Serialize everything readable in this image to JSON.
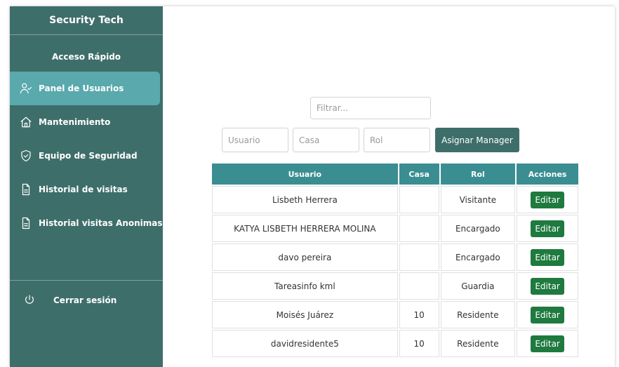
{
  "sidebar": {
    "brand": "Security Tech",
    "section_title": "Acceso Rápido",
    "items": [
      {
        "label": "Panel de Usuarios",
        "icon": "user-check-icon",
        "active": true
      },
      {
        "label": "Mantenimiento",
        "icon": "home-icon"
      },
      {
        "label": "Equipo de Seguridad",
        "icon": "shield-check-icon"
      },
      {
        "label": "Historial de visitas",
        "icon": "document-icon"
      },
      {
        "label": "Historial visitas Anonimas",
        "icon": "document-icon"
      }
    ],
    "logout_label": "Cerrar sesión"
  },
  "filters": {
    "filter_placeholder": "Filtrar...",
    "usuario_placeholder": "Usuario",
    "casa_placeholder": "Casa",
    "rol_placeholder": "Rol",
    "assign_label": "Asignar Manager"
  },
  "table": {
    "headers": [
      "Usuario",
      "Casa",
      "Rol",
      "Acciones"
    ],
    "rows": [
      {
        "usuario": "Lisbeth Herrera",
        "casa": "",
        "rol": "Visitante",
        "action": "Editar"
      },
      {
        "usuario": "KATYA LISBETH HERRERA MOLINA",
        "casa": "",
        "rol": "Encargado",
        "action": "Editar"
      },
      {
        "usuario": "davo pereira",
        "casa": "",
        "rol": "Encargado",
        "action": "Editar"
      },
      {
        "usuario": "Tareasinfo kml",
        "casa": "",
        "rol": "Guardia",
        "action": "Editar"
      },
      {
        "usuario": "Moisés Juárez",
        "casa": "10",
        "rol": "Residente",
        "action": "Editar"
      },
      {
        "usuario": "davidresidente5",
        "casa": "10",
        "rol": "Residente",
        "action": "Editar"
      }
    ]
  },
  "colors": {
    "sidebar_bg": "#3e6e6a",
    "active_item": "#59a9ad",
    "table_header": "#3a8e92",
    "edit_button": "#1e7a3e"
  }
}
